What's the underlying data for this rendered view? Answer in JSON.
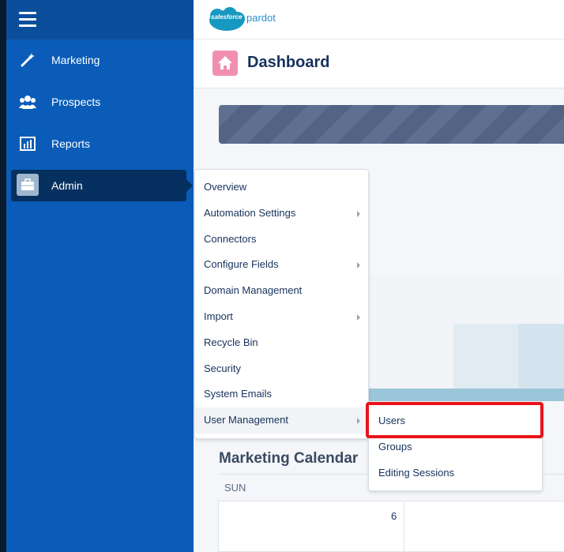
{
  "brand": {
    "logo_word": "salesforce",
    "product": "pardot"
  },
  "sidebar": {
    "items": [
      {
        "label": "Marketing",
        "icon": "wand-icon"
      },
      {
        "label": "Prospects",
        "icon": "people-icon"
      },
      {
        "label": "Reports",
        "icon": "bar-chart-icon"
      },
      {
        "label": "Admin",
        "icon": "briefcase-icon",
        "active": true
      }
    ]
  },
  "header": {
    "title": "Dashboard",
    "icon": "home-icon"
  },
  "admin_menu": {
    "items": [
      {
        "label": "Overview",
        "has_submenu": false
      },
      {
        "label": "Automation Settings",
        "has_submenu": true
      },
      {
        "label": "Connectors",
        "has_submenu": false
      },
      {
        "label": "Configure Fields",
        "has_submenu": true
      },
      {
        "label": "Domain Management",
        "has_submenu": false
      },
      {
        "label": "Import",
        "has_submenu": true
      },
      {
        "label": "Recycle Bin",
        "has_submenu": false
      },
      {
        "label": "Security",
        "has_submenu": false
      },
      {
        "label": "System Emails",
        "has_submenu": false
      },
      {
        "label": "User Management",
        "has_submenu": true,
        "hovered": true
      }
    ]
  },
  "user_management_submenu": {
    "items": [
      {
        "label": "Users",
        "highlighted": true
      },
      {
        "label": "Groups"
      },
      {
        "label": "Editing Sessions"
      }
    ]
  },
  "calendar": {
    "title": "Marketing Calendar",
    "day_header": "SUN",
    "first_date": "6"
  },
  "colors": {
    "sidebar": "#0a5cb8",
    "sidebar_active": "#06305f",
    "highlight_border": "#e8141b",
    "home_badge": "#f08fb2"
  }
}
